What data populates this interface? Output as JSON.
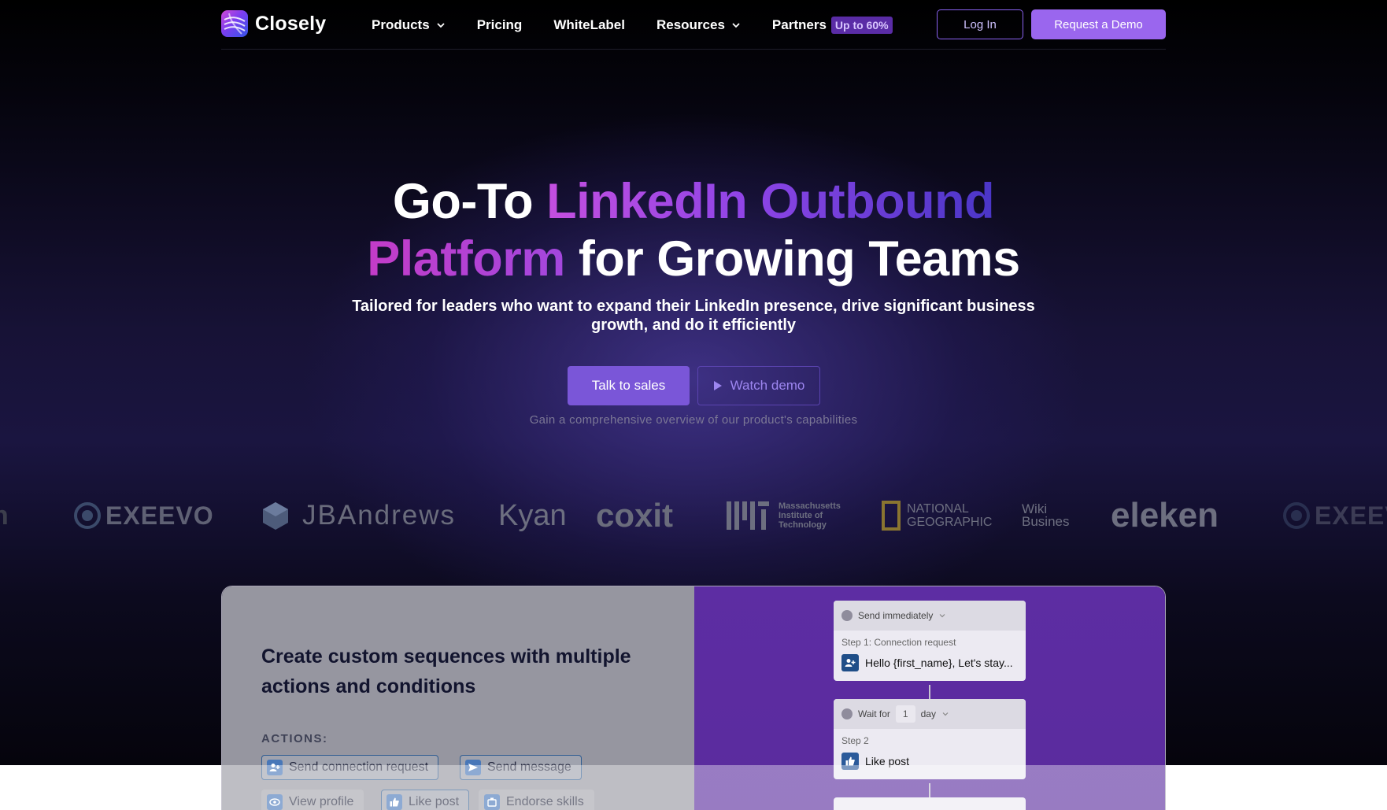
{
  "brand": {
    "name": "Closely"
  },
  "nav": {
    "items": [
      {
        "label": "Products",
        "has_dropdown": true
      },
      {
        "label": "Pricing",
        "has_dropdown": false
      },
      {
        "label": "WhiteLabel",
        "has_dropdown": false
      },
      {
        "label": "Resources",
        "has_dropdown": true
      },
      {
        "label": "Partners",
        "has_dropdown": false,
        "badge": "Up to 60%"
      }
    ],
    "login": "Log In",
    "request_demo": "Request a Demo"
  },
  "hero": {
    "headline_line1_plain": "Go-To ",
    "headline_line1_accent": "LinkedIn Outbound",
    "headline_line2_accent": "Platform",
    "headline_line2_plain": " for Growing Teams",
    "subtitle": "Tailored for leaders who want to expand their LinkedIn presence, drive significant business growth, and do it efficiently",
    "talk_to_sales": "Talk to sales",
    "watch_demo": "Watch demo",
    "caption": "Gain a comprehensive overview of our product's capabilities"
  },
  "client_logos": [
    {
      "name": "EXEEVO",
      "icon": "exeevo-logo"
    },
    {
      "name": "JBAndrews",
      "icon": "jbandrews-logo"
    },
    {
      "name": "Kyan",
      "icon": "kyan-logo"
    },
    {
      "name": "coxit",
      "icon": "coxit-logo"
    },
    {
      "name": "Massachusetts Institute of Technology",
      "line1": "Massachusetts",
      "line2": "Institute of",
      "line3": "Technology",
      "icon": "mit-logo"
    },
    {
      "name": "NATIONAL GEOGRAPHIC",
      "line1": "NATIONAL",
      "line2": "GEOGRAPHIC",
      "icon": "natgeo-logo"
    },
    {
      "name": "Wiki Business",
      "line1": "Wiki",
      "line2": "Busines",
      "icon": "wiki-business-logo"
    },
    {
      "name": "eleken",
      "icon": "eleken-logo"
    }
  ],
  "feature": {
    "title": "Create custom sequences with multiple actions and conditions",
    "actions_label": "ACTIONS:",
    "actions": [
      {
        "label": "Send connection request",
        "icon": "add-user-icon",
        "selected": true
      },
      {
        "label": "Send message",
        "icon": "send-icon",
        "selected": true
      },
      {
        "label": "View profile",
        "icon": "eye-icon",
        "selected": false
      },
      {
        "label": "Like post",
        "icon": "thumbs-up-icon",
        "selected": true
      },
      {
        "label": "Endorse skills",
        "icon": "badge-icon",
        "selected": false
      }
    ],
    "sequence": {
      "step1_header": "Send immediately",
      "step1_label": "Step 1: Connection request",
      "step1_text": "Hello {first_name}, Let's stay...",
      "step2_wait_prefix": "Wait for",
      "step2_wait_value": "1",
      "step2_wait_unit": "day",
      "step2_label": "Step 2",
      "step2_text": "Like post"
    }
  },
  "colors": {
    "accent": "#9a66ee",
    "badge_bg": "#5a2ca6",
    "hero_bg": "#171236",
    "card_right": "#5d2da3"
  }
}
